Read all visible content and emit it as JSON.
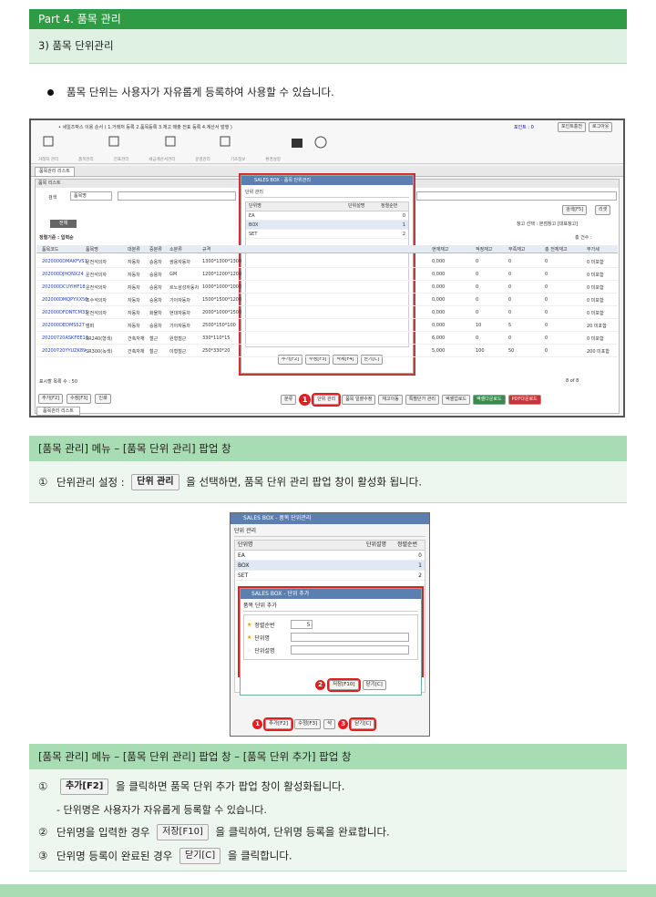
{
  "header": {
    "title": "Part 4. 품목 관리",
    "subtitle": "3) 품목 단위관리"
  },
  "intro": "품목 단위는 사용자가 자유롭게 등록하여 사용할 수 있습니다.",
  "shot1": {
    "ribbon_top": "• 세일즈박스 이용 순서 ( 1.거래처 등록  2.품목등록  3.재고 매출 전표 등록  4.계산서 발행 )",
    "user": "포인트 : 0",
    "point_charge": "포인트충전",
    "logout": "로그아웃",
    "groups": [
      "거래처 관리",
      "품목관리",
      "전표관리",
      "세금계산서관리",
      "운영관리",
      "기초정보",
      "환경설정"
    ],
    "tab": "품목관리 리스트",
    "list_title": "품목 리스트",
    "search_label": "검색",
    "search_field": "품목명",
    "search_btn": "검색[F5]",
    "reset_btn": "리셋",
    "all_btn": "전체",
    "warehouse": "창고 선택 : 본점창고 [대표창고]",
    "sort_label": "정렬기준 : 입력순",
    "total_label": "총 건수 :",
    "columns": [
      "품목코드",
      "품목명",
      "대분류",
      "중분류",
      "소분류",
      "규격"
    ],
    "columns_right": [
      "현재재고",
      "적정재고",
      "부족재고",
      "총 전체재고",
      "부가세"
    ],
    "rows": [
      [
        "2020000DMAKFVS1",
        "운전석의자",
        "자동차",
        "승용차",
        "쌍용자동차",
        "1300*1300*1300"
      ],
      [
        "202000DJHQNX24",
        "운전석의자",
        "자동차",
        "승용차",
        "GM",
        "1200*1200*1200"
      ],
      [
        "202000DCUYIHF18",
        "운전석의자",
        "자동차",
        "승용차",
        "르노삼성자동차",
        "1000*1000*1000"
      ],
      [
        "202000DMQPYXX56",
        "조수석의자",
        "자동차",
        "승용차",
        "기아자동차",
        "1500*1500*1200"
      ],
      [
        "202000DFDNTCM33",
        "운전석의자",
        "자동차",
        "화물차",
        "현대자동차",
        "2000*1000*1500"
      ],
      [
        "202000DEDMSS27",
        "범퍼",
        "자동차",
        "승용차",
        "기아자동차",
        "2500*150*100"
      ],
      [
        "20200720ASKFEE13",
        "SR240(형색)",
        "건축자재",
        "철근",
        "원형철근",
        "330*110*15"
      ],
      [
        "20200720YYUZK89",
        "SR300(녹색)",
        "건축자재",
        "철근",
        "이형철근",
        "250*330*20"
      ]
    ],
    "rows_right": [
      [
        "0,000",
        "0",
        "0",
        "0",
        "0 미포함"
      ],
      [
        "0,000",
        "0",
        "0",
        "0",
        "0 미포함"
      ],
      [
        "0,000",
        "0",
        "0",
        "0",
        "0 미포함"
      ],
      [
        "0,000",
        "0",
        "0",
        "0",
        "0 미포함"
      ],
      [
        "0,000",
        "0",
        "0",
        "0",
        "0 미포함"
      ],
      [
        "0,000",
        "10",
        "5",
        "0",
        "20 미포함"
      ],
      [
        "6,000",
        "0",
        "0",
        "0",
        "0 미포함"
      ],
      [
        "5,000",
        "100",
        "50",
        "0",
        "200 미포함"
      ]
    ],
    "page_size": "표시할 목록 수 : 50",
    "page_info": "8 of 8",
    "bottom_left": [
      "추가[F2]",
      "수정[F3]",
      "인쇄"
    ],
    "bottom_right": [
      "분류",
      "단위 관리",
      "품목 일괄수정",
      "재고이동",
      "특별단가 관리",
      "엑셀업로드",
      "엑셀다운로드",
      "PDF다운로드"
    ],
    "popup": {
      "title": "SALES BOX - 품목 단위관리",
      "section": "단위 관리",
      "cols": [
        "단위명",
        "단위설명",
        "정렬순번"
      ],
      "rows": [
        [
          "EA",
          "",
          "0"
        ],
        [
          "BOX",
          "",
          "1"
        ],
        [
          "SET",
          "",
          "2"
        ]
      ],
      "buttons": [
        "추가[F2]",
        "수정[F3]",
        "삭제[F4]",
        "닫기[C]"
      ]
    },
    "marker": "1"
  },
  "section1": {
    "title": "[품목 관리] 메뉴 – [품목 단위 관리] 팝업 창",
    "num": "①",
    "text_before": "단위관리 설정 :",
    "chip": "단위 관리",
    "text_after": "을 선택하면, 품목 단위 관리 팝업 창이 활성화 됩니다."
  },
  "shot2": {
    "title": "SALES BOX - 품목 단위관리",
    "section": "단위 관리",
    "cols": [
      "단위명",
      "단위설명",
      "정렬순번"
    ],
    "rows": [
      [
        "EA",
        "",
        "0"
      ],
      [
        "BOX",
        "",
        "1"
      ],
      [
        "SET",
        "",
        "2"
      ]
    ],
    "inner_title": "SALES BOX - 단위 추가",
    "inner_section": "품목 단위 추가",
    "fields": [
      "정렬순번",
      "단위명",
      "단위설명"
    ],
    "sort_value": "5",
    "save": "저장[F10]",
    "close": "닫기[C]",
    "bottom": [
      "추가[F2]",
      "수정[F3]",
      "삭",
      "닫기[C]"
    ],
    "markers": [
      "1",
      "2",
      "3"
    ]
  },
  "section2": {
    "title": "[품목 관리] 메뉴 – [품목 단위 관리] 팝업 창 – [품목 단위 추가] 팝업 창",
    "l1_num": "①",
    "l1_chip": "추가[F2]",
    "l1_text": "을 클릭하면 품목 단위 추가 팝업 창이 활성화됩니다.",
    "l2": "-  단위명은 사용자가 자유롭게 등록할 수 있습니다.",
    "l3_num": "②",
    "l3_before": "단위명을 입력한 경우",
    "l3_chip": "저장[F10]",
    "l3_after": "을 클릭하여, 단위명 등록을 완료합니다.",
    "l4_num": "③",
    "l4_before": "단위명 등록이 완료된 경우",
    "l4_chip": "닫기[C]",
    "l4_after": "을 클릭합니다."
  }
}
